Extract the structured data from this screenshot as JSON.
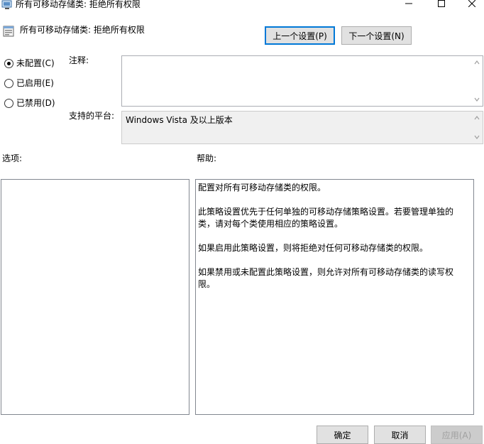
{
  "window": {
    "title": "所有可移动存储类: 拒绝所有权限"
  },
  "header": {
    "policy_title": "所有可移动存储类: 拒绝所有权限",
    "prev_button": "上一个设置(P)",
    "next_button": "下一个设置(N)"
  },
  "state": {
    "options": [
      {
        "label": "未配置(C)",
        "checked": true
      },
      {
        "label": "已启用(E)",
        "checked": false
      },
      {
        "label": "已禁用(D)",
        "checked": false
      }
    ]
  },
  "comment": {
    "label": "注释:",
    "value": ""
  },
  "platform": {
    "label": "支持的平台:",
    "value": "Windows Vista 及以上版本"
  },
  "options_section": {
    "label": "选项:"
  },
  "help_section": {
    "label": "帮助:",
    "paragraphs": [
      "配置对所有可移动存储类的权限。",
      "此策略设置优先于任何单独的可移动存储策略设置。若要管理单独的类，请对每个类使用相应的策略设置。",
      "如果启用此策略设置，则将拒绝对任何可移动存储类的权限。",
      "如果禁用或未配置此策略设置，则允许对所有可移动存储类的读写权限。"
    ]
  },
  "footer": {
    "ok": "确定",
    "cancel": "取消",
    "apply": "应用(A)"
  }
}
